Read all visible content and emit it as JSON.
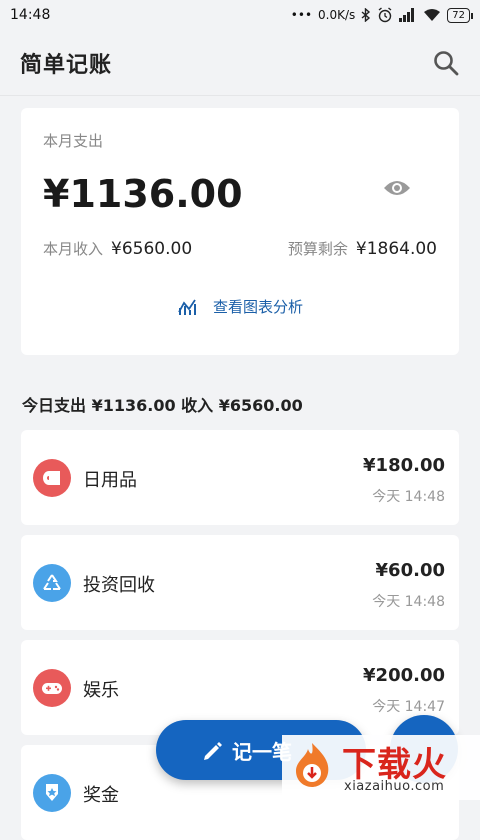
{
  "status": {
    "time": "14:48",
    "network_speed": "0.0K/s",
    "battery": "72"
  },
  "appbar": {
    "title": "简单记账"
  },
  "summary": {
    "month_expense_label": "本月支出",
    "month_expense": "¥1136.00",
    "month_income_label": "本月收入",
    "month_income": "¥6560.00",
    "budget_label": "预算剩余",
    "budget_remaining": "¥1864.00",
    "chart_link": "查看图表分析"
  },
  "today": {
    "header": "今日支出 ¥1136.00 收入 ¥6560.00"
  },
  "items": [
    {
      "name": "日用品",
      "amount": "¥180.00",
      "time": "今天 14:48",
      "color": "#e85a5a"
    },
    {
      "name": "投资回收",
      "amount": "¥60.00",
      "time": "今天 14:48",
      "color": "#4aa3e8"
    },
    {
      "name": "娱乐",
      "amount": "¥200.00",
      "time": "今天 14:47",
      "color": "#e85a5a"
    },
    {
      "name": "奖金",
      "amount": "",
      "time": "",
      "color": "#4aa3e8"
    }
  ],
  "fab": {
    "label": "记一笔"
  },
  "watermark": {
    "title": "下载火",
    "url": "xiazaihuo.com"
  },
  "colors": {
    "accent": "#1565c0",
    "expense_red": "#e85a5a",
    "income_blue": "#4aa3e8"
  }
}
